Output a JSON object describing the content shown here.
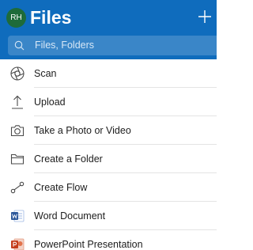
{
  "header": {
    "avatar_initials": "RH",
    "title": "Files",
    "brand_color": "#0f6cbd",
    "avatar_color": "#1e6b3a",
    "add_icon": "plus-icon"
  },
  "search": {
    "placeholder": "Files, Folders",
    "icon": "search-icon"
  },
  "menu": {
    "items": [
      {
        "label": "Scan",
        "icon": "scan-icon"
      },
      {
        "label": "Upload",
        "icon": "upload-icon"
      },
      {
        "label": "Take a Photo or Video",
        "icon": "camera-icon"
      },
      {
        "label": "Create a Folder",
        "icon": "folder-icon"
      },
      {
        "label": "Create Flow",
        "icon": "flow-icon"
      },
      {
        "label": "Word Document",
        "icon": "word-document-icon"
      },
      {
        "label": "PowerPoint Presentation",
        "icon": "powerpoint-icon"
      }
    ]
  }
}
